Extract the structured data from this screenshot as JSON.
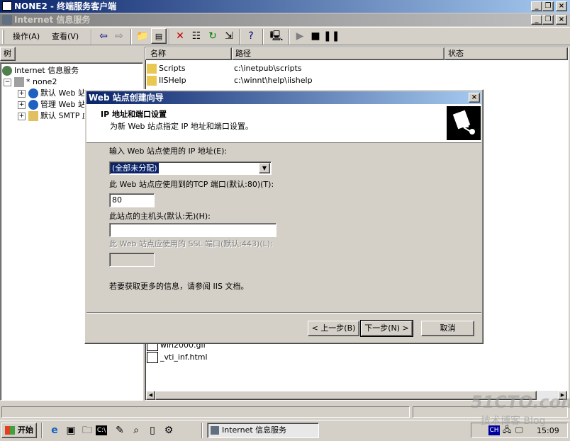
{
  "outer_window": {
    "title": "NONE2 - 终端服务客户端"
  },
  "mmc_window": {
    "title": "Internet 信息服务"
  },
  "menu": {
    "action": "操作(A)",
    "view": "查看(V)"
  },
  "tree": {
    "header": "树",
    "root": "Internet 信息服务",
    "server": "* none2",
    "items": [
      "默认 Web 站",
      "管理 Web 站",
      "默认 SMTP 虚"
    ]
  },
  "listview": {
    "columns": [
      "名称",
      "路径",
      "状态"
    ],
    "rows_top": [
      {
        "name": "Scripts",
        "path": "c:\\inetpub\\scripts"
      },
      {
        "name": "IISHelp",
        "path": "c:\\winnt\\help\\iishelp"
      }
    ],
    "rows_bottom": [
      {
        "name": "win2000.gif"
      },
      {
        "name": "_vti_inf.html"
      }
    ]
  },
  "wizard": {
    "title": "Web 站点创建向导",
    "header_title": "IP 地址和端口设置",
    "header_subtitle": "为新 Web 站点指定 IP 地址和端口设置。",
    "ip_label": "输入 Web 站点使用的 IP 地址(E):",
    "ip_value": "(全部未分配)",
    "tcp_label": "此 Web 站点应使用到的TCP 端口(默认:80)(T):",
    "tcp_value": "80",
    "host_label": "此站点的主机头(默认:无)(H):",
    "host_value": "",
    "ssl_label": "此 Web 站点应使用的 SSL 端口(默认:443)(L):",
    "info_text": "若要获取更多的信息，请参阅 IIS 文档。",
    "back_button": "< 上一步(B)",
    "next_button": "下一步(N) >",
    "cancel_button": "取消"
  },
  "taskbar": {
    "start": "开始",
    "task": "Internet 信息服务",
    "clock": "15:09"
  },
  "watermark": {
    "line1": "51CTO.com",
    "line2": "技术博客 Blog"
  }
}
